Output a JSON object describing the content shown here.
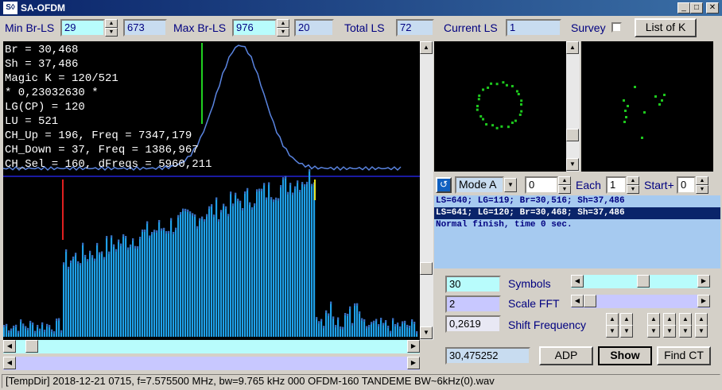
{
  "window": {
    "title": "SA-OFDM",
    "logo": "S◊"
  },
  "top": {
    "min_br_ls_label": "Min Br-LS",
    "min_br_ls": "29",
    "min_br_ls_aux": "673",
    "max_br_ls_label": "Max Br-LS",
    "max_br_ls": "976",
    "max_br_ls_aux": "20",
    "total_ls_label": "Total LS",
    "total_ls": "72",
    "current_ls_label": "Current LS",
    "current_ls": "1",
    "survey_label": "Survey",
    "list_k_label": "List of K"
  },
  "info_lines": [
    "Br = 30,468",
    "Sh = 37,486",
    "Magic K = 120/521",
    "* 0,23032630 *",
    "LG(CP) = 120",
    "LU = 521",
    "CH_Up = 196, Freq = 7347,179",
    "CH_Down = 37, Freq = 1386,967",
    "CH_Sel = 160, dFreqs = 5960,211"
  ],
  "mode_row": {
    "mode": "Mode A",
    "mode_value": "0",
    "each_label": "Each",
    "each_value": "1",
    "start_label": "Start+",
    "start_value": "0"
  },
  "log": [
    "LS=640; LG=119; Br=30,516; Sh=37,486",
    "LS=641; LG=120; Br=30,468; Sh=37,486",
    "Normal finish, time 0 sec."
  ],
  "controls": {
    "symbols_value": "30",
    "symbols_label": "Symbols",
    "symbols_level": 0.47,
    "scale_fft_value": "2",
    "scale_fft_label": "Scale FFT",
    "scale_fft_level": 0.0,
    "shift_value": "0,2619",
    "shift_label": "Shift Frequency",
    "freq_value": "30,475252",
    "adp_label": "ADP",
    "show_label": "Show",
    "find_ct_label": "Find CT"
  },
  "status": "[TempDir] 2018-12-21 0715, f=7.575500 MHz, bw=9.765 kHz 000 OFDM-160 TANDEME BW~6kHz(0).wav",
  "colors": {
    "bars": "#1fa0e8",
    "bar_tops": "#3a6dbf",
    "constellation": "#1ec81e",
    "curve": "#5a84e0",
    "marker_green": "#20d020",
    "marker_red": "#e02020",
    "marker_yellow": "#e8e020"
  }
}
